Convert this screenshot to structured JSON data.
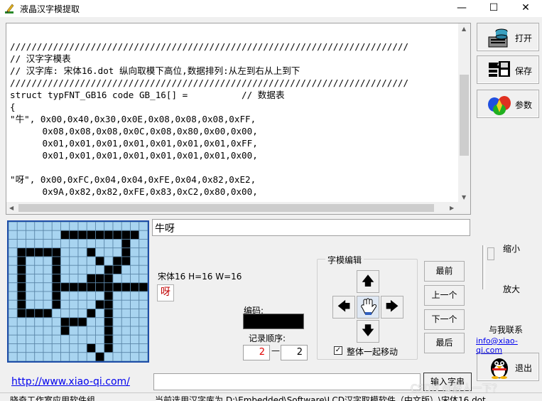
{
  "window": {
    "title": "液晶汉字模提取",
    "minimize": "—",
    "maximize": "☐",
    "close": "✕"
  },
  "code": {
    "lines": [
      "//////////////////////////////////////////////////////////////////////////",
      "// 汉字字模表",
      "// 汉字库: 宋体16.dot 纵向取模下高位,数据排列:从左到右从上到下",
      "//////////////////////////////////////////////////////////////////////////",
      "struct typFNT_GB16 code GB_16[] =          // 数据表",
      "{",
      "\"牛\", 0x00,0x40,0x30,0x0E,0x08,0x08,0x08,0xFF,",
      "      0x08,0x08,0x08,0x0C,0x08,0x80,0x00,0x00,",
      "      0x01,0x01,0x01,0x01,0x01,0x01,0x01,0xFF,",
      "      0x01,0x01,0x01,0x01,0x01,0x01,0x01,0x00,",
      "",
      "\"呀\", 0x00,0xFC,0x04,0x04,0xFE,0x04,0x82,0xE2,",
      "      0x9A,0x82,0x82,0xFE,0x83,0xC2,0x80,0x00,"
    ]
  },
  "side_buttons": {
    "open": "打开",
    "save": "保存",
    "params": "参数",
    "exit": "退出"
  },
  "input_text": "牛呀",
  "font_info": "宋体16 H=16 W=16",
  "preview_char": "呀",
  "encoding_label": "编码:",
  "record_order_label": "记录顺序:",
  "record_current": "2",
  "record_separator": "—",
  "record_total": "2",
  "editor": {
    "title": "字模编辑",
    "move_all_label": "整体一起移动",
    "move_all_checked": "✓"
  },
  "nav": {
    "first": "最前",
    "prev": "上一个",
    "next": "下一个",
    "last": "最后"
  },
  "zoom": {
    "in": "缩小",
    "out": "放大"
  },
  "contact": {
    "label": "与我联系",
    "email": "info@xiao-qi.com"
  },
  "url": "http://www.xiao-qi.com/",
  "enter_button": "输入字串",
  "status": {
    "left": "晓奇工作室应用软件组",
    "right": "当前选用汉字库为 D:\\Embedded\\Software\\LCD汉字取模软件（中文版）\\宋体16.dot"
  },
  "watermark": "CSDN @敲人一下？",
  "glyph_rows": [
    "0000000000000000",
    "0000001111111110",
    "0000000000000100",
    "0111110001000100",
    "0100010000101100",
    "0100010000011000",
    "0100010001110000",
    "0100011111111111",
    "0100010000010000",
    "0100010000110000",
    "0111100001010000",
    "0000001110010000",
    "0000001000010000",
    "0000000000010000",
    "0000000001010000",
    "0000000000100000"
  ]
}
